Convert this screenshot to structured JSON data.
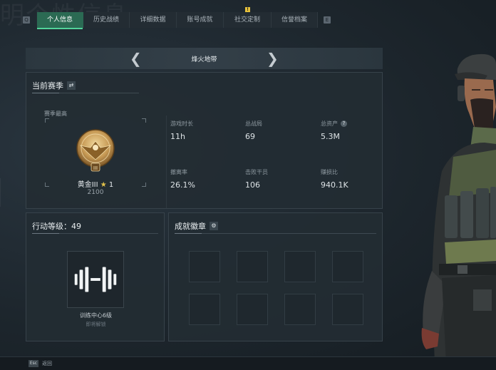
{
  "background": {
    "title_text": "明个性信息"
  },
  "nav": {
    "left_key": "Q",
    "right_key": "E",
    "tabs": [
      {
        "label": "个人信息",
        "active": true
      },
      {
        "label": "历史战绩",
        "active": false
      },
      {
        "label": "详细数据",
        "active": false
      },
      {
        "label": "账号成就",
        "active": false
      },
      {
        "label": "社交定制",
        "active": false,
        "badge": "!"
      },
      {
        "label": "信誉档案",
        "active": false
      }
    ]
  },
  "mode": {
    "title": "烽火地带",
    "prev_icon": "chevron-left-icon",
    "next_icon": "chevron-right-icon"
  },
  "season": {
    "title": "当前赛季",
    "switch_icon": "swap-icon",
    "rank_label": "赛季最高",
    "rank_name": "黄金III",
    "rank_stars": "1",
    "rank_score": "2100",
    "stats": [
      {
        "label": "游戏时长",
        "value": "11h"
      },
      {
        "label": "总战局",
        "value": "69"
      },
      {
        "label": "总资产",
        "value": "5.3M",
        "help": "?"
      },
      {
        "label": "撤离率",
        "value": "26.1%"
      },
      {
        "label": "击败干员",
        "value": "106"
      },
      {
        "label": "赚损比",
        "value": "940.1K"
      }
    ]
  },
  "level": {
    "title": "行动等级：49",
    "item_label": "训练中心6级",
    "item_sub": "即将解锁"
  },
  "achievements": {
    "title": "成就徽章",
    "settings_icon": "gear-icon"
  },
  "footer": {
    "esc_key": "Esc",
    "back_label": "返回"
  },
  "colors": {
    "accent": "#2b6a53",
    "accent_line": "#52d39a",
    "gold": "#c9a25a",
    "notice": "#e6c13c"
  }
}
